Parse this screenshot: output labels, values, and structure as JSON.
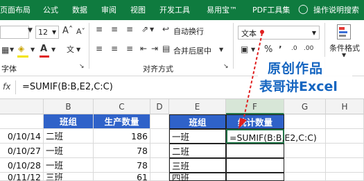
{
  "menu": [
    "页面布局",
    "公式",
    "数据",
    "审阅",
    "视图",
    "开发工具",
    "易用宝™",
    "PDF工具集",
    "操作说明搜索"
  ],
  "ribbon": {
    "font_size": "12",
    "font_group_label": "字体",
    "align_group_label": "对齐方式",
    "wrap_text": "自动换行",
    "merge_center": "合并后居中",
    "number_format": "文本",
    "percent": "%",
    "conditional_format": "条件格式"
  },
  "annotation": {
    "line1": "原创作品",
    "line2": "表哥讲Excel"
  },
  "formula_bar": {
    "fx": "fx",
    "formula": "=SUMIF(B:B,E2,C:C)"
  },
  "columns": [
    "B",
    "C",
    "D",
    "E",
    "F",
    "G",
    "H"
  ],
  "table1": {
    "headers": [
      "班组",
      "生产数量"
    ],
    "rows": [
      {
        "date": "0/10/14",
        "team": "二班",
        "qty": "186"
      },
      {
        "date": "0/10/27",
        "team": "一班",
        "qty": "78"
      },
      {
        "date": "0/10/28",
        "team": "一班",
        "qty": "78"
      },
      {
        "date": "0/11/12",
        "team": "三班",
        "qty": "61"
      }
    ]
  },
  "table2": {
    "headers": [
      "班组",
      "统计数量"
    ],
    "rows": [
      "一班",
      "二班",
      "三班",
      "四班"
    ],
    "active_formula": "=SUMIF(B:B,E2,C:C)"
  },
  "colors": {
    "menubar": "#0f7b3f",
    "header_fill": "#2f62c9",
    "arrow": "#e02020",
    "note_text": "#1565c0"
  }
}
